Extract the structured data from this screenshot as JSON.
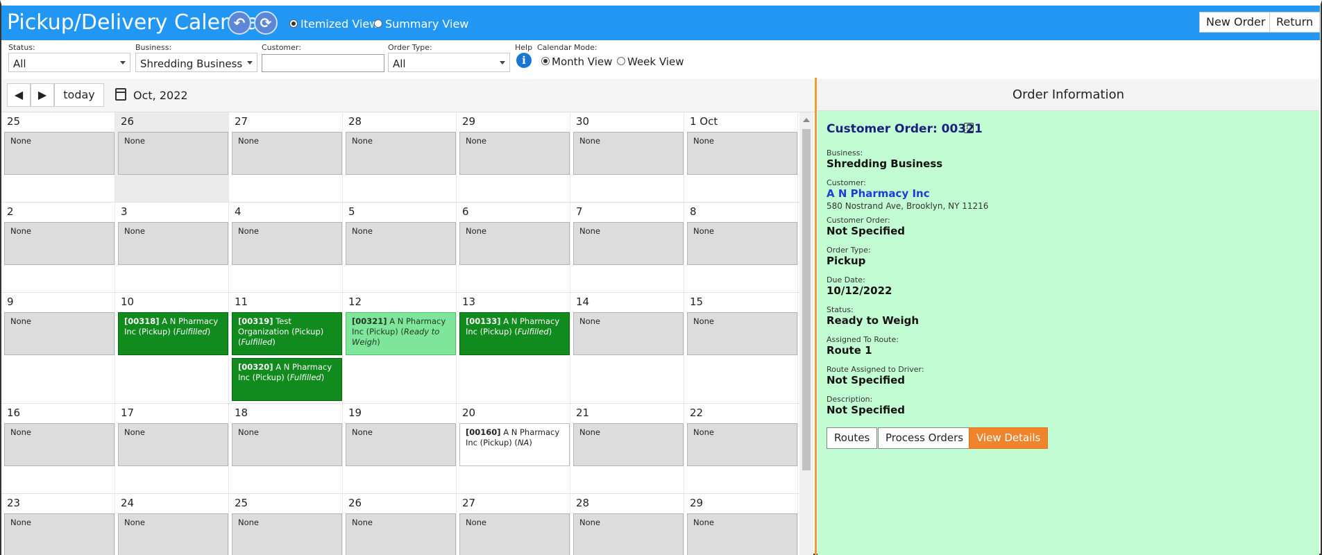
{
  "header": {
    "title": "Pickup/Delivery Calendar",
    "back_icon": "undo-arrow-icon",
    "refresh_icon": "refresh-icon",
    "view_options": [
      {
        "label": "Itemized View",
        "selected": true
      },
      {
        "label": "Summary View",
        "selected": false
      }
    ],
    "new_order_label": "New Order",
    "return_label": "Return",
    "bg_color": "#2196f3"
  },
  "filters": {
    "status_label": "Status:",
    "status_value": "All",
    "business_label": "Business:",
    "business_value": "Shredding Business",
    "customer_label": "Customer:",
    "customer_value": "",
    "order_type_label": "Order Type:",
    "order_type_value": "All",
    "help_label": "Help",
    "calendar_mode_label": "Calendar Mode:",
    "mode_options": [
      {
        "label": "Month View",
        "selected": true
      },
      {
        "label": "Week View",
        "selected": false
      }
    ]
  },
  "calendar": {
    "today_label": "today",
    "month_label": "Oct, 2022",
    "weeks": [
      {
        "days": [
          {
            "num": "25",
            "events": [
              {
                "text": "None",
                "kind": "none"
              }
            ]
          },
          {
            "num": "26",
            "shaded": true,
            "events": [
              {
                "text": "None",
                "kind": "none"
              }
            ]
          },
          {
            "num": "27",
            "events": [
              {
                "text": "None",
                "kind": "none"
              }
            ]
          },
          {
            "num": "28",
            "events": [
              {
                "text": "None",
                "kind": "none"
              }
            ]
          },
          {
            "num": "29",
            "events": [
              {
                "text": "None",
                "kind": "none"
              }
            ]
          },
          {
            "num": "30",
            "events": [
              {
                "text": "None",
                "kind": "none"
              }
            ]
          },
          {
            "num": "1 Oct",
            "events": [
              {
                "text": "None",
                "kind": "none"
              }
            ]
          }
        ]
      },
      {
        "days": [
          {
            "num": "2",
            "events": [
              {
                "text": "None",
                "kind": "none"
              }
            ]
          },
          {
            "num": "3",
            "events": [
              {
                "text": "None",
                "kind": "none"
              }
            ]
          },
          {
            "num": "4",
            "events": [
              {
                "text": "None",
                "kind": "none"
              }
            ]
          },
          {
            "num": "5",
            "events": [
              {
                "text": "None",
                "kind": "none"
              }
            ]
          },
          {
            "num": "6",
            "events": [
              {
                "text": "None",
                "kind": "none"
              }
            ]
          },
          {
            "num": "7",
            "events": [
              {
                "text": "None",
                "kind": "none"
              }
            ]
          },
          {
            "num": "8",
            "events": [
              {
                "text": "None",
                "kind": "none"
              }
            ]
          }
        ]
      },
      {
        "days": [
          {
            "num": "9",
            "events": [
              {
                "text": "None",
                "kind": "none"
              }
            ]
          },
          {
            "num": "10",
            "events": [
              {
                "id": "[00318]",
                "text": "A N Pharmacy Inc (Pickup)",
                "status": "Fulfilled",
                "kind": "done"
              }
            ]
          },
          {
            "num": "11",
            "events": [
              {
                "id": "[00319]",
                "text": "Test Organization (Pickup)",
                "status": "Fulfilled",
                "kind": "done"
              },
              {
                "id": "[00320]",
                "text": "A N Pharmacy Inc (Pickup)",
                "status": "Fulfilled",
                "kind": "done"
              }
            ]
          },
          {
            "num": "12",
            "events": [
              {
                "id": "[00321]",
                "text": "A N Pharmacy Inc (Pickup)",
                "status": "Ready to Weigh",
                "kind": "ready"
              }
            ]
          },
          {
            "num": "13",
            "events": [
              {
                "id": "[00133]",
                "text": "A N Pharmacy Inc (Pickup)",
                "status": "Fulfilled",
                "kind": "done"
              }
            ]
          },
          {
            "num": "14",
            "events": [
              {
                "text": "None",
                "kind": "none"
              }
            ]
          },
          {
            "num": "15",
            "events": [
              {
                "text": "None",
                "kind": "none"
              }
            ]
          }
        ]
      },
      {
        "days": [
          {
            "num": "16",
            "events": [
              {
                "text": "None",
                "kind": "none"
              }
            ]
          },
          {
            "num": "17",
            "events": [
              {
                "text": "None",
                "kind": "none"
              }
            ]
          },
          {
            "num": "18",
            "events": [
              {
                "text": "None",
                "kind": "none"
              }
            ]
          },
          {
            "num": "19",
            "events": [
              {
                "text": "None",
                "kind": "none"
              }
            ]
          },
          {
            "num": "20",
            "events": [
              {
                "id": "[00160]",
                "text": "A N Pharmacy Inc (Pickup)",
                "status": "NA",
                "kind": "na"
              }
            ]
          },
          {
            "num": "21",
            "events": [
              {
                "text": "None",
                "kind": "none"
              }
            ]
          },
          {
            "num": "22",
            "events": [
              {
                "text": "None",
                "kind": "none"
              }
            ]
          }
        ]
      },
      {
        "days": [
          {
            "num": "23",
            "events": [
              {
                "text": "None",
                "kind": "none"
              }
            ]
          },
          {
            "num": "24",
            "events": [
              {
                "text": "None",
                "kind": "none"
              }
            ]
          },
          {
            "num": "25",
            "events": [
              {
                "text": "None",
                "kind": "none"
              }
            ]
          },
          {
            "num": "26",
            "events": [
              {
                "text": "None",
                "kind": "none"
              }
            ]
          },
          {
            "num": "27",
            "events": [
              {
                "text": "None",
                "kind": "none"
              }
            ]
          },
          {
            "num": "28",
            "events": [
              {
                "text": "None",
                "kind": "none"
              }
            ]
          },
          {
            "num": "29",
            "events": [
              {
                "text": "None",
                "kind": "none"
              }
            ]
          }
        ]
      }
    ]
  },
  "order": {
    "panel_title": "Order Information",
    "title": "Customer Order: 00321",
    "fields": {
      "business_label": "Business:",
      "business_value": "Shredding Business",
      "customer_label": "Customer:",
      "customer_value": "A N Pharmacy Inc",
      "customer_address": "580 Nostrand Ave, Brooklyn, NY 11216",
      "customer_order_label": "Customer Order:",
      "customer_order_value": "Not Specified",
      "order_type_label": "Order Type:",
      "order_type_value": "Pickup",
      "due_date_label": "Due Date:",
      "due_date_value": "10/12/2022",
      "status_label": "Status:",
      "status_value": "Ready to Weigh",
      "route_label": "Assigned To Route:",
      "route_value": "Route 1",
      "driver_label": "Route Assigned to Driver:",
      "driver_value": "Not Specified",
      "description_label": "Description:",
      "description_value": "Not Specified"
    },
    "buttons": {
      "routes": "Routes",
      "process_orders": "Process Orders",
      "view_details": "View Details"
    },
    "bg_color": "#c2fcd2",
    "accent_color": "#f0842c"
  }
}
